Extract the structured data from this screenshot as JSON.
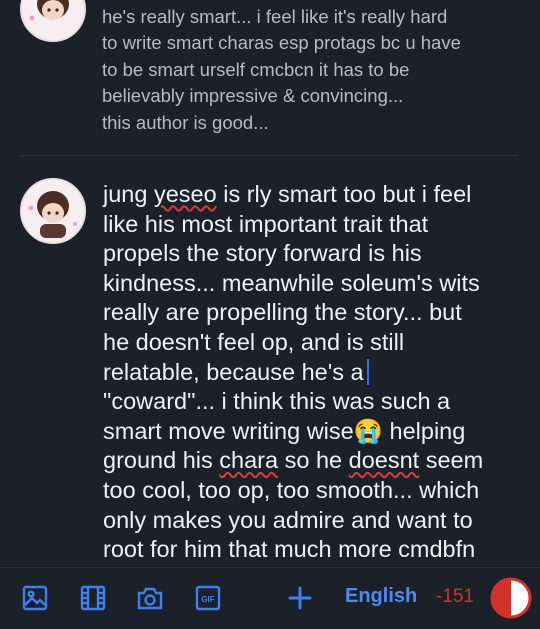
{
  "previous_post": {
    "lines": [
      "he's really smart... i feel like it's really hard",
      "to write smart charas esp protags bc u have",
      "to be smart urself cmcbcn it has to be",
      "believably impressive & convincing...",
      "this author is good..."
    ]
  },
  "draft": {
    "l1a": "jung ",
    "l1b": "yeseo",
    "l1c": " is rly smart too but i feel",
    "l2": "like his most important trait that",
    "l3": "propels the story forward is his",
    "l4": "kindness... meanwhile soleum's wits",
    "l5": "really are propelling the story... but",
    "l6": "he doesn't feel op, and is still",
    "l7": "relatable, because he's a",
    "l8": "\"coward\"... i think this was such a",
    "l9a": "smart move writing wise",
    "l9emoji": "😭",
    "l9b": " helping",
    "l10a": "ground his ",
    "l10b": "chara",
    "l10c": " so he ",
    "l10d": "doesnt",
    "l10e": " seem",
    "l11": "too cool, too op, too smooth... which",
    "l12": "only makes you admire and want to",
    "l13": "root for him that much more cmdbfn"
  },
  "toolbar": {
    "language": "English",
    "char_count": "-151",
    "gif_label": "GIF",
    "icons": [
      "image-icon",
      "film-icon",
      "camera-icon",
      "gif-icon",
      "plus-icon"
    ],
    "accent_color": "#3d7ff0",
    "warning_color": "#d6302b",
    "progress_fraction": 0.5
  }
}
